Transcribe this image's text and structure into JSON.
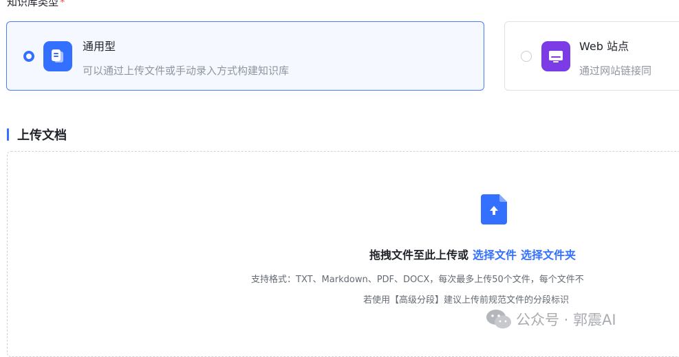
{
  "kb_type": {
    "label": "知识库类型",
    "required_mark": "*",
    "options": [
      {
        "title": "通用型",
        "desc": "可以通过上传文件或手动录入方式构建知识库",
        "selected": true,
        "icon": "document-icon",
        "color": "#3370ff"
      },
      {
        "title": "Web 站点",
        "desc": "通过网站链接同",
        "selected": false,
        "icon": "monitor-icon",
        "color": "#7b3ce6"
      }
    ]
  },
  "upload": {
    "section_title": "上传文档",
    "prompt": "拖拽文件至此上传或",
    "select_file": "选择文件",
    "select_folder": "选择文件夹",
    "formats_hint": "支持格式：TXT、Markdown、PDF、DOCX，每次最多上传50个文件，每个文件不",
    "advanced_hint": "若使用【高级分段】建议上传前规范文件的分段标识",
    "icon": "file-upload-icon"
  },
  "watermark": {
    "text": "公众号 · 郭震AI",
    "icon": "wechat-icon"
  },
  "colors": {
    "accent": "#3370ff",
    "purple": "#7b3ce6",
    "required": "#f54a45"
  }
}
